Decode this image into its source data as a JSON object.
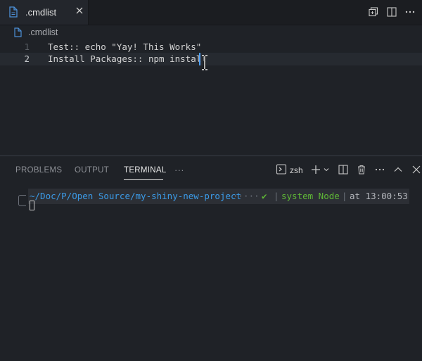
{
  "tab": {
    "filename": ".cmdlist"
  },
  "breadcrumb": {
    "filename": ".cmdlist"
  },
  "editor": {
    "lines": [
      {
        "number": "1",
        "text": "Test:: echo \"Yay! This Works\""
      },
      {
        "number": "2",
        "text": "Install Packages:: npm install"
      }
    ]
  },
  "panel": {
    "tabs": [
      {
        "label": "PROBLEMS"
      },
      {
        "label": "OUTPUT"
      },
      {
        "label": "TERMINAL"
      },
      {
        "label": "···"
      }
    ],
    "shell": "zsh"
  },
  "terminal": {
    "path": "~/Doc/P/Open Source/my-shiny-new-project",
    "dots": "·····",
    "check": "✔",
    "node_label": "system Node",
    "time": "at 13:00:53"
  },
  "colors": {
    "accent": "#4fa1ff",
    "path": "#3b9be8",
    "node": "#5fb836",
    "check": "#5fb836"
  }
}
